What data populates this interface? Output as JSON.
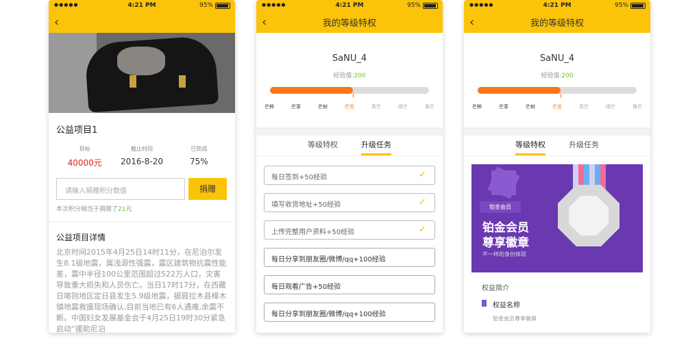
{
  "status": {
    "time": "4:21 PM",
    "battery": "95%"
  },
  "screen1": {
    "project_title": "公益项目1",
    "stats": [
      {
        "label": "目标",
        "value": "40000元"
      },
      {
        "label": "截止时间",
        "value": "2016-8-20"
      },
      {
        "label": "已完成",
        "value": "75%"
      }
    ],
    "input_placeholder": "请输入捐赠积分数值",
    "donate_label": "捐赠",
    "note_prefix": "本次积分相当于捐赠了",
    "note_amount": "21元",
    "detail_title": "公益项目详情",
    "detail_text": "北京时间2015年4月25日14时11分，在尼泊尔发生8.1级地震，属浅源性强震，震区建筑物抗震性能差，震中半径100公里范围超过522万人口，灾害导致重大损失和人员伤亡。当日17时17分，在西藏日喀则地区定日县发生5.9级地震，据聂拉木县樟木镇地震救援现场确认,目前当地已有6人遇难,余震不断。中国妇女发展基金会于4月25日19时30分紧急启动“援助尼泊"
  },
  "level": {
    "title": "我的等级特权",
    "username": "SaNU_4",
    "exp_label": "经验值:",
    "exp_value": "200",
    "progress": 0.52,
    "stages": [
      "芒种",
      "芒芽",
      "芒树",
      "芒花",
      "青芒",
      "绿芒",
      "黄芒"
    ],
    "current_stage_index": 3,
    "tabs": [
      "等级特权",
      "升级任务"
    ]
  },
  "screen2": {
    "active_tab": 1,
    "tasks": [
      {
        "label": "每日签到+50经验",
        "done": true
      },
      {
        "label": "填写收货地址+50经验",
        "done": true
      },
      {
        "label": "上传完整用户资料+50经验",
        "done": true
      },
      {
        "label": "每日分享到朋友圈/微博/qq+100经验",
        "done": false
      },
      {
        "label": "每日观看广告+50经验",
        "done": false
      },
      {
        "label": "每日分享到朋友圈/微博/qq+100经验",
        "done": false
      }
    ]
  },
  "screen3": {
    "active_tab": 0,
    "badge_level": "铂金会员",
    "badge_line1": "铂金会员",
    "badge_line2": "尊享徽章",
    "badge_sub": "不一样的身份体现",
    "perk_header": "权益简介",
    "perk_name": "权益名称",
    "perk_desc": "铂金会员尊享徽章"
  },
  "colors": {
    "accent": "#fcc408",
    "progress": "#f7761d",
    "badge_bg": "#6a38b0",
    "exp_green": "#6abf3a",
    "target_red": "#e02020"
  }
}
